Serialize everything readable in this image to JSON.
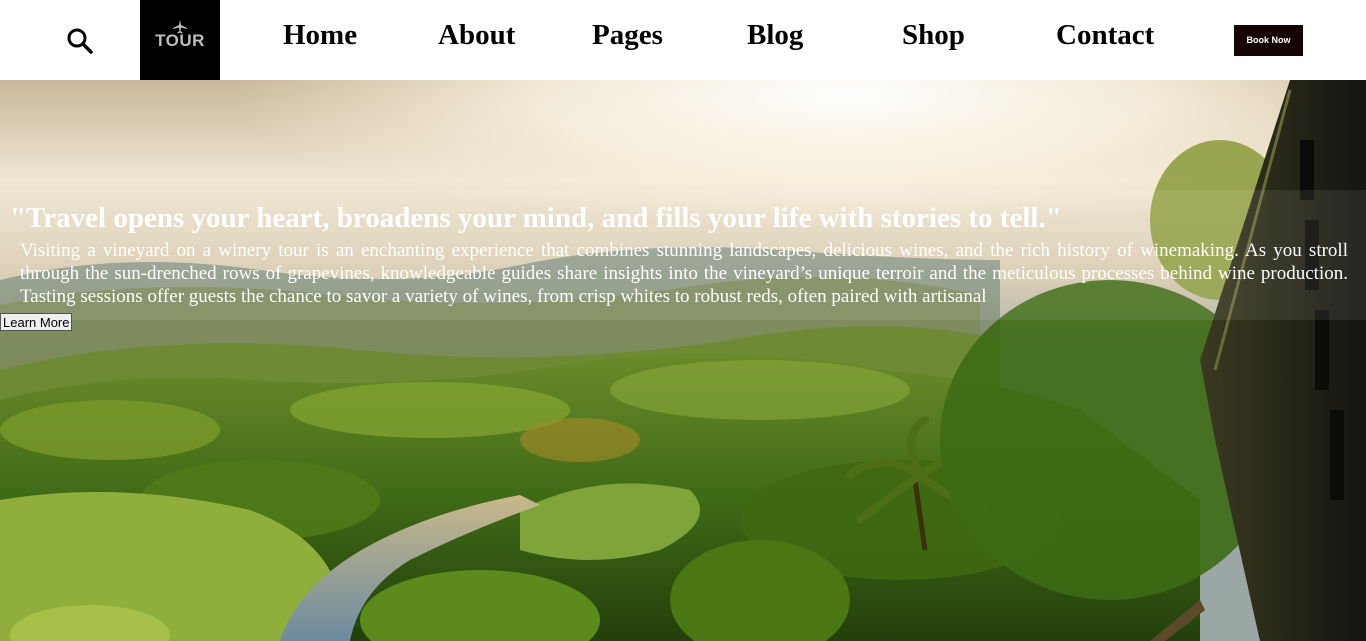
{
  "header": {
    "logo_text": "TOUR",
    "nav": [
      "Home",
      "About",
      "Pages",
      "Blog",
      "Shop",
      "Contact"
    ],
    "book_label": "Book Now"
  },
  "hero": {
    "quote": "\"Travel opens your heart, broadens your mind, and fills your life with stories to tell.\"",
    "description": "Visiting a vineyard on a winery tour is an enchanting experience that combines stunning landscapes, delicious wines, and the rich history of winemaking. As you stroll through the sun-drenched rows of grapevines, knowledgeable guides share insights into the vineyard’s unique terroir and the meticulous processes behind wine production. Tasting sessions offer guests the chance to savor a variety of wines, from crisp whites to robust reds, often paired with artisanal",
    "button_label": "Learn More"
  },
  "icons": {
    "search": "search-icon",
    "logo": "airplane-icon"
  },
  "colors": {
    "logo_bg": "#000000",
    "book_button_bg": "#140404",
    "foliage": "#4a7a1a",
    "sky": "#f6efe0"
  }
}
